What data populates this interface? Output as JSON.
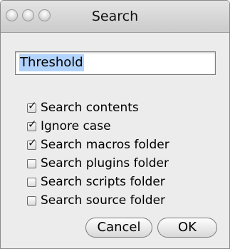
{
  "window": {
    "title": "Search"
  },
  "search": {
    "value": "Threshold"
  },
  "options": [
    {
      "label": "Search contents",
      "checked": true
    },
    {
      "label": "Ignore case",
      "checked": true
    },
    {
      "label": "Search macros folder",
      "checked": true
    },
    {
      "label": "Search plugins folder",
      "checked": false
    },
    {
      "label": "Search scripts folder",
      "checked": false
    },
    {
      "label": "Search source folder",
      "checked": false
    }
  ],
  "buttons": {
    "cancel_label": "Cancel",
    "ok_label": "OK"
  },
  "icons": {
    "check": "✓"
  }
}
